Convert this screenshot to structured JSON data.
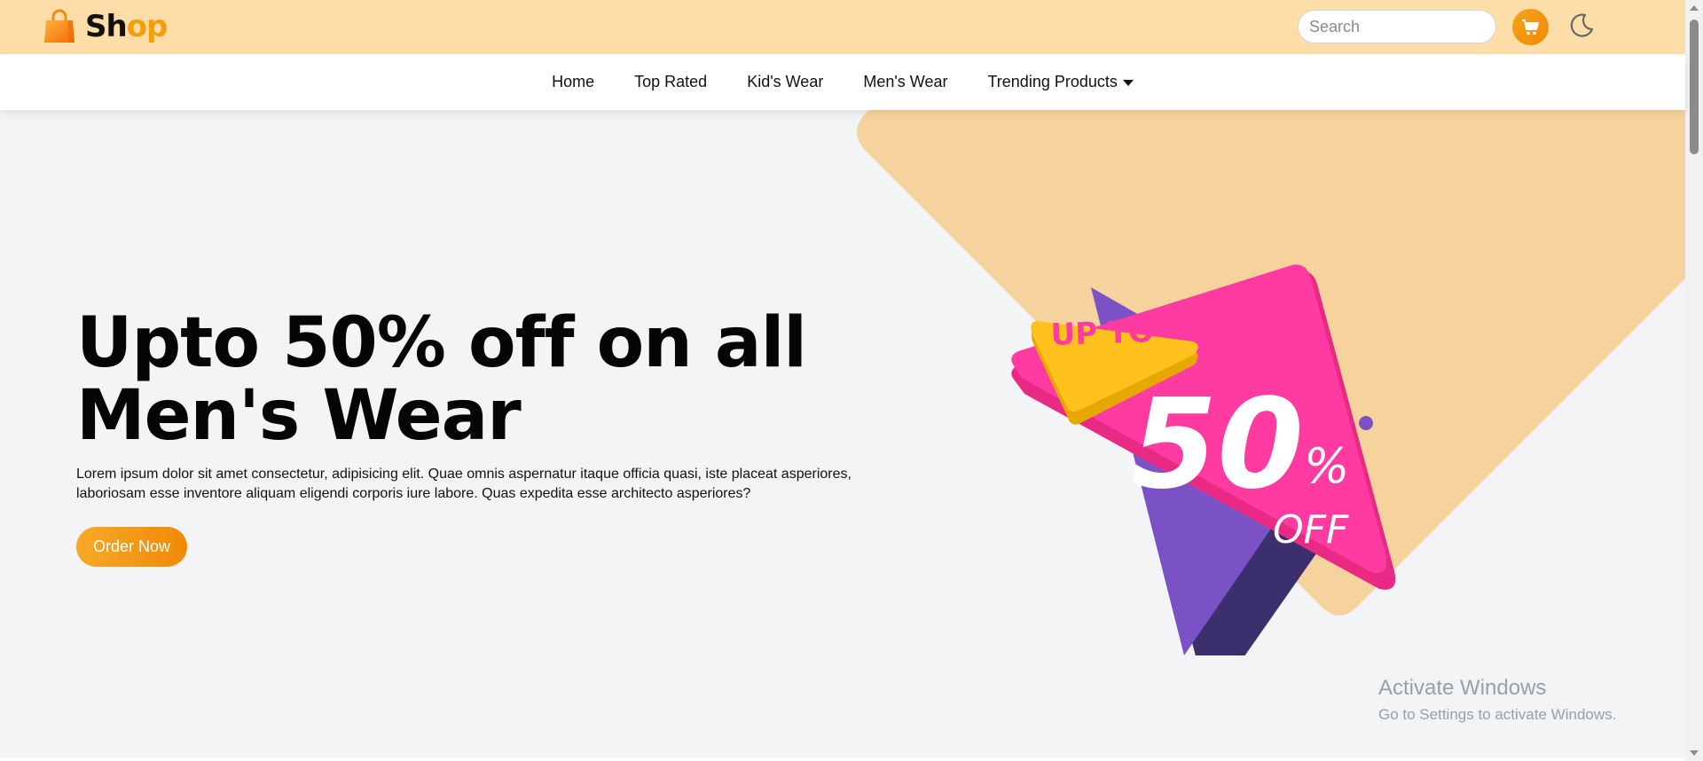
{
  "header": {
    "logo_text_part1": "Sh",
    "logo_text_part2": "op",
    "search_placeholder": "Search",
    "brand_color": "#f59e0b",
    "topbar_color": "#fedea8"
  },
  "nav": {
    "items": [
      {
        "label": "Home"
      },
      {
        "label": "Top Rated"
      },
      {
        "label": "Kid's Wear"
      },
      {
        "label": "Men's Wear"
      },
      {
        "label": "Trending Products"
      }
    ]
  },
  "hero": {
    "headline_line1": "Upto 50% off on all",
    "headline_line2": "Men's Wear",
    "body": "Lorem ipsum dolor sit amet consectetur, adipisicing elit. Quae omnis aspernatur itaque officia quasi, iste placeat asperiores, laboriosam esse inventore aliquam eligendi corporis iure labore. Quas expedita esse architecto asperiores?",
    "cta_label": "Order Now",
    "promo": {
      "up_to": "UP TO",
      "number": "50",
      "percent": "%",
      "off": "OFF"
    }
  },
  "watermark": {
    "title": "Activate Windows",
    "subtitle": "Go to Settings to activate Windows."
  }
}
